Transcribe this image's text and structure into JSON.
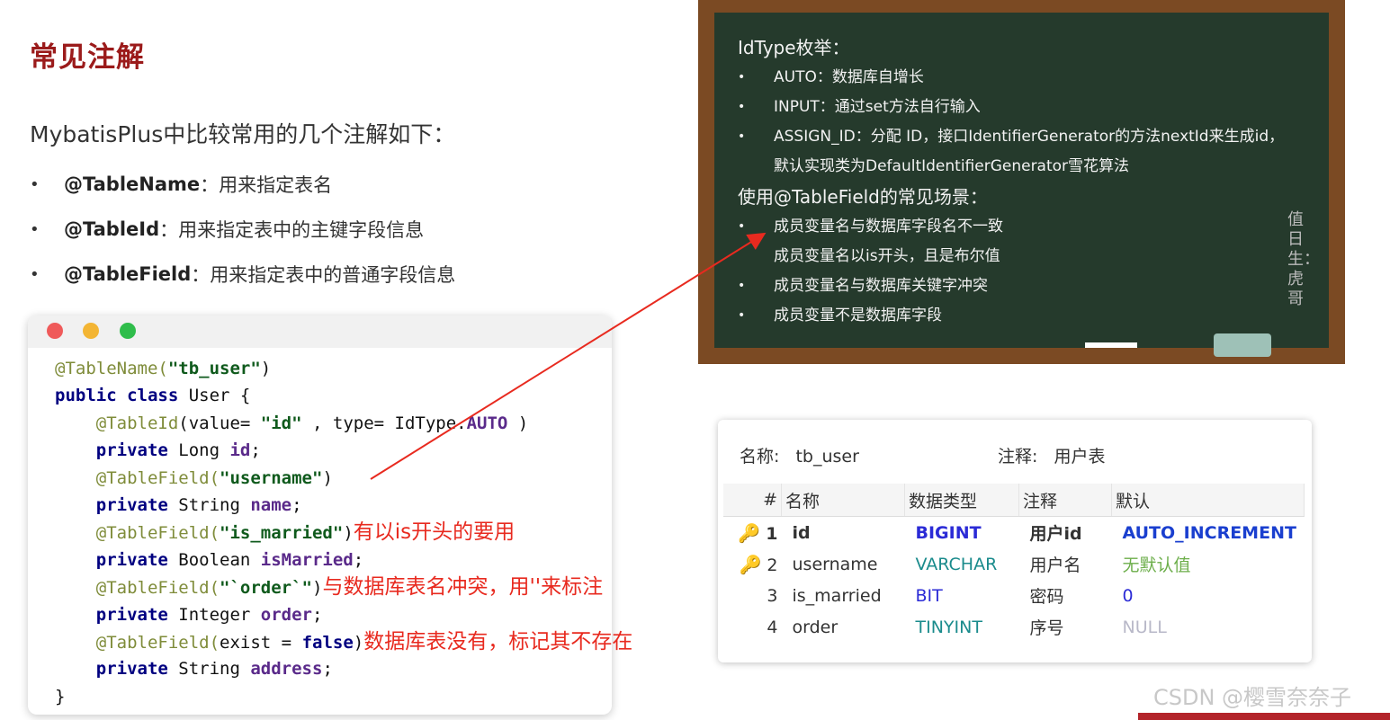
{
  "page_title": "常见注解",
  "intro": "MybatisPlus中比较常用的几个注解如下：",
  "bullets": [
    {
      "name": "@TableName",
      "desc": "：用来指定表名"
    },
    {
      "name": "@TableId",
      "desc": "：用来指定表中的主键字段信息"
    },
    {
      "name": "@TableField",
      "desc": "：用来指定表中的普通字段信息"
    }
  ],
  "code": {
    "l1": {
      "ann": "@TableName(",
      "str": "\"tb_user\"",
      "close": ")"
    },
    "l2": {
      "kw1": "public",
      "kw2": "class",
      "rest": " User {"
    },
    "l3": {
      "ann": "@TableId",
      "p1": "(value= ",
      "str": "\"id\"",
      "p2": " , type= IdType.",
      "fld": "AUTO",
      "p3": " )"
    },
    "l4": {
      "kw": "private",
      "type": " Long ",
      "fld": "id",
      "end": ";"
    },
    "l5": {
      "ann": "@TableField(",
      "str": "\"username\"",
      "close": ")"
    },
    "l6": {
      "kw": "private",
      "type": " String ",
      "fld": "name",
      "end": ";"
    },
    "l7": {
      "ann": "@TableField(",
      "str": "\"is_married\"",
      "close": ")",
      "note": "有以is开头的要用"
    },
    "l8": {
      "kw": "private",
      "type": " Boolean ",
      "fld": "isMarried",
      "end": ";"
    },
    "l9": {
      "ann": "@TableField(",
      "str": "\"`order`\"",
      "close": ")",
      "note": "与数据库表名冲突，用''来标注"
    },
    "l10": {
      "kw": "private",
      "type": " Integer ",
      "fld": "order",
      "end": ";"
    },
    "l11": {
      "ann": "@TableField(",
      "p1": "exist = ",
      "kw": "false",
      "close": ")",
      "note": "数据库表没有，标记其不存在"
    },
    "l12": {
      "kw": "private",
      "type": " String ",
      "fld": "address",
      "end": ";"
    },
    "l13": "}"
  },
  "board": {
    "head1": "IdType枚举：",
    "items1": [
      "AUTO：数据库自增长",
      "INPUT：通过set方法自行输入",
      "ASSIGN_ID：分配 ID，接口IdentifierGenerator的方法nextId来生成id，"
    ],
    "cont1": "默认实现类为DefaultIdentifierGenerator雪花算法",
    "head2": "使用@TableField的常见场景：",
    "items2": [
      "成员变量名与数据库字段名不一致",
      "成员变量名以is开头，且是布尔值",
      "成员变量名与数据库关键字冲突",
      "成员变量不是数据库字段"
    ],
    "side_text": "值日生：虎哥"
  },
  "db": {
    "name_label": "名称:",
    "name_value": "tb_user",
    "comment_label": "注释:",
    "comment_value": "用户表",
    "columns": [
      "#",
      "名称",
      "数据类型",
      "注释",
      "默认"
    ],
    "rows": [
      {
        "num": "1",
        "name": "id",
        "type": "BIGINT",
        "comment": "用户id",
        "default": "AUTO_INCREMENT"
      },
      {
        "num": "2",
        "name": "username",
        "type": "VARCHAR",
        "comment": "用户名",
        "default": "无默认值"
      },
      {
        "num": "3",
        "name": "is_married",
        "type": "BIT",
        "comment": "密码",
        "default": "0"
      },
      {
        "num": "4",
        "name": "order",
        "type": "TINYINT",
        "comment": "序号",
        "default": "NULL"
      }
    ]
  },
  "watermark": "CSDN @樱雪奈奈子",
  "colors": {
    "title": "#9b1b1b",
    "note": "#e82a1f",
    "arrow": "#e82a1f"
  }
}
